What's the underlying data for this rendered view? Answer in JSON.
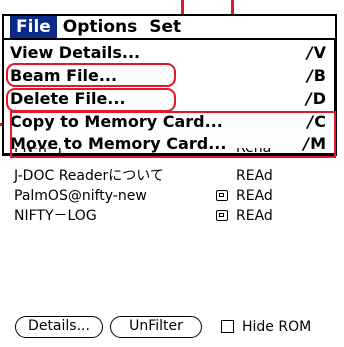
{
  "menubar": {
    "menus": [
      "File",
      "Options",
      "Set"
    ]
  },
  "file_menu": {
    "items": [
      {
        "label": "View Details...",
        "shortcut": "V"
      },
      {
        "label": "Beam File...",
        "shortcut": "B"
      },
      {
        "label": "Delete File...",
        "shortcut": "D"
      },
      {
        "label": "Copy to Memory Card...",
        "shortcut": "C"
      },
      {
        "label": "Move to Memory Card...",
        "shortcut": "M"
      }
    ],
    "shortcut_stroke": "/"
  },
  "file_list": {
    "partial_row": {
      "name": "PN-n--J",
      "status": "Rena"
    },
    "rows": [
      {
        "name": "J-DOC Readerについて",
        "status": "REAd",
        "card_icon": false
      },
      {
        "name": "PalmOS@nifty-new",
        "status": "REAd",
        "card_icon": true
      },
      {
        "name": "NIFTY－LOG",
        "status": "REAd",
        "card_icon": true
      }
    ]
  },
  "buttons": {
    "details": "Details...",
    "unfilter": "UnFilter"
  },
  "hide_rom": {
    "label": "Hide ROM",
    "checked": false
  },
  "colors": {
    "highlight": "#e0182a",
    "menu_active": "#0a2a8a"
  }
}
